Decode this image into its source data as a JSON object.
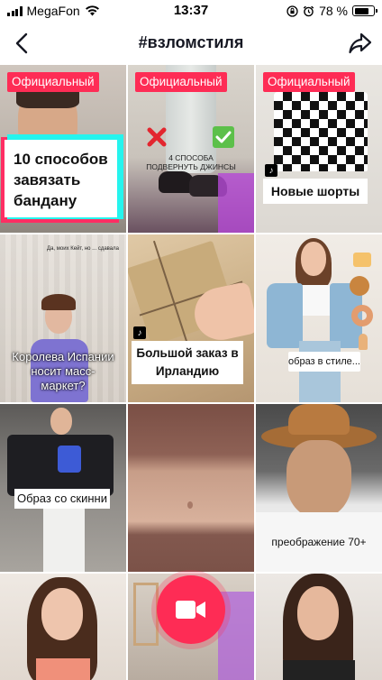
{
  "status_bar": {
    "carrier": "MegaFon",
    "time": "13:37",
    "battery": "78 %",
    "battery_level": 0.78
  },
  "nav": {
    "title": "#взломстиля",
    "back_icon": "chevron-left-icon",
    "share_icon": "share-arrow-icon"
  },
  "tiles": {
    "t1": {
      "badge": "Официальный",
      "caption": "10 способов завязать бандану"
    },
    "t2": {
      "badge": "Официальный",
      "overlay_line1": "4 СПОСОБА",
      "overlay_line2": "ПОДВЕРНУТЬ ДЖИНСЫ"
    },
    "t3": {
      "badge": "Официальный",
      "caption": "Новые шорты"
    },
    "t4": {
      "top_text": "Да, моих Кейт, но ... сдавала",
      "caption": "Королева Испании носит масс-маркет?"
    },
    "t5": {
      "caption": "Большой заказ в Ирландию"
    },
    "t6": {
      "caption": "образ в стиле..."
    },
    "t7": {
      "caption": "Образ со скинни"
    },
    "t9": {
      "caption": "преображение 70+"
    }
  },
  "colors": {
    "accent": "#fe2c55",
    "text": "#161823"
  }
}
